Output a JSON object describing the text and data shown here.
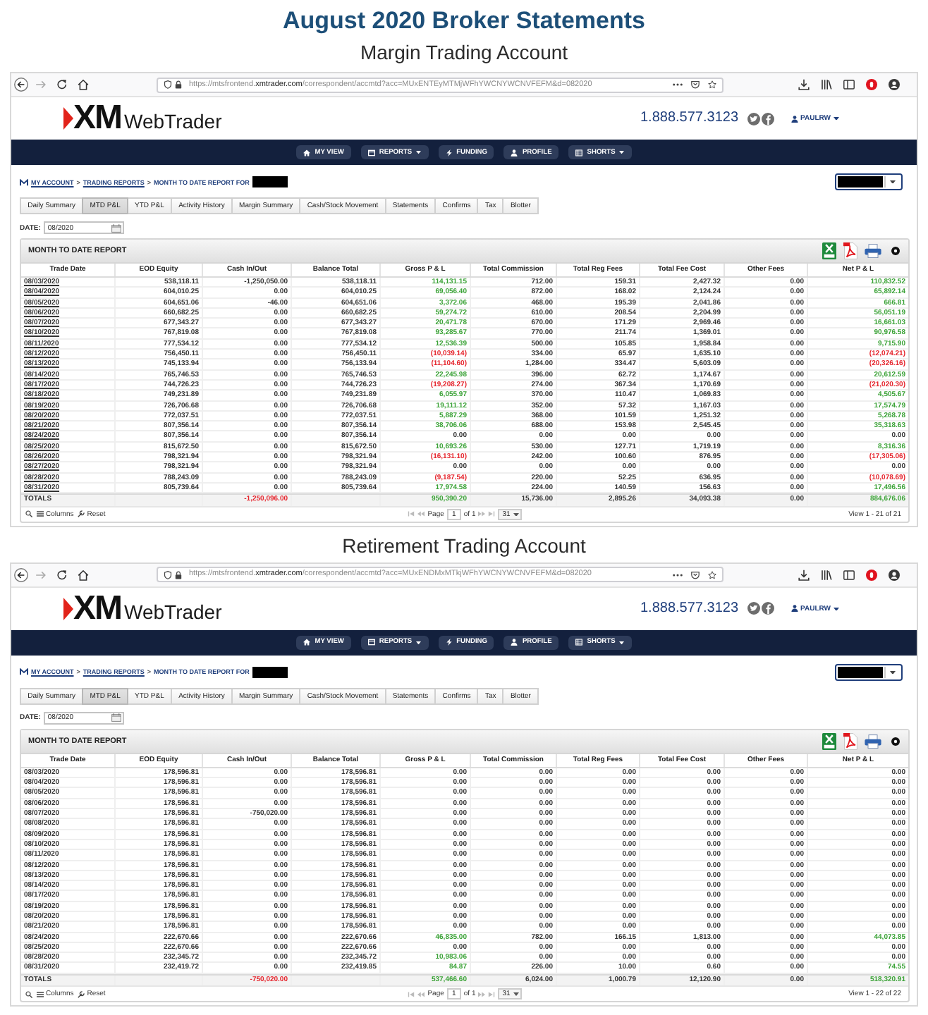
{
  "page": {
    "title": "August 2020 Broker Statements"
  },
  "sections": [
    {
      "subtitle": "Margin Trading Account",
      "browser": {
        "url_prefix": "https://mtsfrontend.",
        "url_domain": "xmtrader.com",
        "url_path": "/correspondent/accmtd?acc=MUxENTEyMTMjWFhYWCNYWCNVFEFM&d=082020"
      },
      "site": {
        "logo_mark": "XM",
        "logo_text": "WebTrader",
        "phone": "1.888.577.3123",
        "user": "PAULRW"
      },
      "nav": [
        {
          "label": "MY VIEW",
          "dropdown": false
        },
        {
          "label": "REPORTS",
          "dropdown": true
        },
        {
          "label": "FUNDING",
          "dropdown": false
        },
        {
          "label": "PROFILE",
          "dropdown": false
        },
        {
          "label": "SHORTS",
          "dropdown": true
        }
      ],
      "breadcrumb": [
        {
          "kind": "link",
          "label": "MY ACCOUNT"
        },
        {
          "kind": "separator",
          "label": ">"
        },
        {
          "kind": "link",
          "label": "TRADING REPORTS"
        },
        {
          "kind": "separator",
          "label": ">"
        },
        {
          "kind": "current",
          "label": "MONTH TO DATE REPORT FOR"
        }
      ],
      "tabs": [
        {
          "label": "Daily Summary",
          "selected": false
        },
        {
          "label": "MTD P&L",
          "selected": true
        },
        {
          "label": "YTD P&L",
          "selected": false
        },
        {
          "label": "Activity History",
          "selected": false
        },
        {
          "label": "Margin Summary",
          "selected": false
        },
        {
          "label": "Cash/Stock Movement",
          "selected": false
        },
        {
          "label": "Statements",
          "selected": false
        },
        {
          "label": "Confirms",
          "selected": false
        },
        {
          "label": "Tax",
          "selected": false
        },
        {
          "label": "Blotter",
          "selected": false
        }
      ],
      "date": {
        "label": "DATE:",
        "value": "08/2020"
      },
      "report": {
        "title": "MONTH TO DATE REPORT",
        "date_links": true,
        "columns": [
          "Trade Date",
          "EOD Equity",
          "Cash In/Out",
          "Balance Total",
          "Gross P & L",
          "Total Commission",
          "Total Reg Fees",
          "Total Fee Cost",
          "Other Fees",
          "Net P & L"
        ],
        "rows": [
          {
            "cells": [
              "08/03/2020",
              "538,118.11",
              "-1,250,050.00",
              "538,118.11",
              "114,131.15",
              "712.00",
              "159.31",
              "2,427.32",
              "0.00",
              "110,832.52"
            ],
            "gross_gain": true,
            "gross_loss": false,
            "net_gain": true,
            "net_loss": false
          },
          {
            "cells": [
              "08/04/2020",
              "604,010.25",
              "0.00",
              "604,010.25",
              "69,056.40",
              "872.00",
              "168.02",
              "2,124.24",
              "0.00",
              "65,892.14"
            ],
            "gross_gain": true,
            "gross_loss": false,
            "net_gain": true,
            "net_loss": false
          },
          {
            "cells": [
              "08/05/2020",
              "604,651.06",
              "-46.00",
              "604,651.06",
              "3,372.06",
              "468.00",
              "195.39",
              "2,041.86",
              "0.00",
              "666.81"
            ],
            "gross_gain": true,
            "gross_loss": false,
            "net_gain": true,
            "net_loss": false
          },
          {
            "cells": [
              "08/06/2020",
              "660,682.25",
              "0.00",
              "660,682.25",
              "59,274.72",
              "610.00",
              "208.54",
              "2,204.99",
              "0.00",
              "56,051.19"
            ],
            "gross_gain": true,
            "gross_loss": false,
            "net_gain": true,
            "net_loss": false
          },
          {
            "cells": [
              "08/07/2020",
              "677,343.27",
              "0.00",
              "677,343.27",
              "20,471.78",
              "670.00",
              "171.29",
              "2,969.46",
              "0.00",
              "16,661.03"
            ],
            "gross_gain": true,
            "gross_loss": false,
            "net_gain": true,
            "net_loss": false
          },
          {
            "cells": [
              "08/10/2020",
              "767,819.08",
              "0.00",
              "767,819.08",
              "93,285.67",
              "770.00",
              "211.74",
              "1,369.01",
              "0.00",
              "90,976.58"
            ],
            "gross_gain": true,
            "gross_loss": false,
            "net_gain": true,
            "net_loss": false
          },
          {
            "cells": [
              "08/11/2020",
              "777,534.12",
              "0.00",
              "777,534.12",
              "12,536.39",
              "500.00",
              "105.85",
              "1,958.84",
              "0.00",
              "9,715.90"
            ],
            "gross_gain": true,
            "gross_loss": false,
            "net_gain": true,
            "net_loss": false
          },
          {
            "cells": [
              "08/12/2020",
              "756,450.11",
              "0.00",
              "756,450.11",
              "(10,039.14)",
              "334.00",
              "65.97",
              "1,635.10",
              "0.00",
              "(12,074.21)"
            ],
            "gross_gain": false,
            "gross_loss": true,
            "net_gain": false,
            "net_loss": true
          },
          {
            "cells": [
              "08/13/2020",
              "745,133.94",
              "0.00",
              "756,133.94",
              "(11,104.60)",
              "1,284.00",
              "334.47",
              "5,603.09",
              "0.00",
              "(20,326.16)"
            ],
            "gross_gain": false,
            "gross_loss": true,
            "net_gain": false,
            "net_loss": true
          },
          {
            "cells": [
              "08/14/2020",
              "765,746.53",
              "0.00",
              "765,746.53",
              "22,245.98",
              "396.00",
              "62.72",
              "1,174.67",
              "0.00",
              "20,612.59"
            ],
            "gross_gain": true,
            "gross_loss": false,
            "net_gain": true,
            "net_loss": false
          },
          {
            "cells": [
              "08/17/2020",
              "744,726.23",
              "0.00",
              "744,726.23",
              "(19,208.27)",
              "274.00",
              "367.34",
              "1,170.69",
              "0.00",
              "(21,020.30)"
            ],
            "gross_gain": false,
            "gross_loss": true,
            "net_gain": false,
            "net_loss": true
          },
          {
            "cells": [
              "08/18/2020",
              "749,231.89",
              "0.00",
              "749,231.89",
              "6,055.97",
              "370.00",
              "110.47",
              "1,069.83",
              "0.00",
              "4,505.67"
            ],
            "gross_gain": true,
            "gross_loss": false,
            "net_gain": true,
            "net_loss": false
          },
          {
            "cells": [
              "08/19/2020",
              "726,706.68",
              "0.00",
              "726,706.68",
              "19,111.12",
              "352.00",
              "57.32",
              "1,167.03",
              "0.00",
              "17,574.79"
            ],
            "gross_gain": true,
            "gross_loss": false,
            "net_gain": true,
            "net_loss": false
          },
          {
            "cells": [
              "08/20/2020",
              "772,037.51",
              "0.00",
              "772,037.51",
              "5,887.29",
              "368.00",
              "101.59",
              "1,251.32",
              "0.00",
              "5,268.78"
            ],
            "gross_gain": true,
            "gross_loss": false,
            "net_gain": true,
            "net_loss": false
          },
          {
            "cells": [
              "08/21/2020",
              "807,356.14",
              "0.00",
              "807,356.14",
              "38,706.06",
              "688.00",
              "153.98",
              "2,545.45",
              "0.00",
              "35,318.63"
            ],
            "gross_gain": true,
            "gross_loss": false,
            "net_gain": true,
            "net_loss": false
          },
          {
            "cells": [
              "08/24/2020",
              "807,356.14",
              "0.00",
              "807,356.14",
              "0.00",
              "0.00",
              "0.00",
              "0.00",
              "0.00",
              "0.00"
            ],
            "gross_gain": false,
            "gross_loss": false,
            "net_gain": false,
            "net_loss": false
          },
          {
            "cells": [
              "08/25/2020",
              "815,672.50",
              "0.00",
              "815,672.50",
              "10,693.26",
              "530.00",
              "127.71",
              "1,719.19",
              "0.00",
              "8,316.36"
            ],
            "gross_gain": true,
            "gross_loss": false,
            "net_gain": true,
            "net_loss": false
          },
          {
            "cells": [
              "08/26/2020",
              "798,321.94",
              "0.00",
              "798,321.94",
              "(16,131.10)",
              "242.00",
              "100.60",
              "876.95",
              "0.00",
              "(17,305.06)"
            ],
            "gross_gain": false,
            "gross_loss": true,
            "net_gain": false,
            "net_loss": true
          },
          {
            "cells": [
              "08/27/2020",
              "798,321.94",
              "0.00",
              "798,321.94",
              "0.00",
              "0.00",
              "0.00",
              "0.00",
              "0.00",
              "0.00"
            ],
            "gross_gain": false,
            "gross_loss": false,
            "net_gain": false,
            "net_loss": false
          },
          {
            "cells": [
              "08/28/2020",
              "788,243.09",
              "0.00",
              "788,243.09",
              "(9,187.54)",
              "220.00",
              "52.25",
              "636.95",
              "0.00",
              "(10,078.69)"
            ],
            "gross_gain": false,
            "gross_loss": true,
            "net_gain": false,
            "net_loss": true
          },
          {
            "cells": [
              "08/31/2020",
              "805,739.64",
              "0.00",
              "805,739.64",
              "17,974.58",
              "224.00",
              "140.59",
              "156.63",
              "0.00",
              "17,496.56"
            ],
            "gross_gain": true,
            "gross_loss": false,
            "net_gain": true,
            "net_loss": false
          }
        ],
        "totals": {
          "label": "TOTALS",
          "cash_in_out": "-1,250,096.00",
          "cash_gain": false,
          "cash_loss": true,
          "gross_p_l": "950,390.20",
          "gross_gain": true,
          "gross_loss": false,
          "total_commission": "15,736.00",
          "total_reg_fees": "2,895.26",
          "total_fee_cost": "34,093.38",
          "other_fees": "0.00",
          "net_p_l": "884,676.06",
          "net_gain": true,
          "net_loss": false
        },
        "pager": {
          "columns": "Columns",
          "reset": "Reset",
          "page_label": "Page",
          "page": "1",
          "page_of": "of 1",
          "page_size": "31",
          "view": "View 1 - 21 of 21"
        }
      }
    },
    {
      "subtitle": "Retirement Trading Account",
      "browser": {
        "url_prefix": "https://mtsfrontend.",
        "url_domain": "xmtrader.com",
        "url_path": "/correspondent/accmtd?acc=MUxENDMxMTkjWFhYWCNYWCNVFEFM&d=082020"
      },
      "site": {
        "logo_mark": "XM",
        "logo_text": "WebTrader",
        "phone": "1.888.577.3123",
        "user": "PAULRW"
      },
      "nav": [
        {
          "label": "MY VIEW",
          "dropdown": false
        },
        {
          "label": "REPORTS",
          "dropdown": true
        },
        {
          "label": "FUNDING",
          "dropdown": false
        },
        {
          "label": "PROFILE",
          "dropdown": false
        },
        {
          "label": "SHORTS",
          "dropdown": true
        }
      ],
      "breadcrumb": [
        {
          "kind": "link",
          "label": "MY ACCOUNT"
        },
        {
          "kind": "separator",
          "label": ">"
        },
        {
          "kind": "link",
          "label": "TRADING REPORTS"
        },
        {
          "kind": "separator",
          "label": ">"
        },
        {
          "kind": "current",
          "label": "MONTH TO DATE REPORT FOR"
        }
      ],
      "tabs": [
        {
          "label": "Daily Summary",
          "selected": false
        },
        {
          "label": "MTD P&L",
          "selected": true
        },
        {
          "label": "YTD P&L",
          "selected": false
        },
        {
          "label": "Activity History",
          "selected": false
        },
        {
          "label": "Margin Summary",
          "selected": false
        },
        {
          "label": "Cash/Stock Movement",
          "selected": false
        },
        {
          "label": "Statements",
          "selected": false
        },
        {
          "label": "Confirms",
          "selected": false
        },
        {
          "label": "Tax",
          "selected": false
        },
        {
          "label": "Blotter",
          "selected": false
        }
      ],
      "date": {
        "label": "DATE:",
        "value": "08/2020"
      },
      "report": {
        "title": "MONTH TO DATE REPORT",
        "date_links": false,
        "columns": [
          "Trade Date",
          "EOD Equity",
          "Cash In/Out",
          "Balance Total",
          "Gross P & L",
          "Total Commission",
          "Total Reg Fees",
          "Total Fee Cost",
          "Other Fees",
          "Net P & L"
        ],
        "rows": [
          {
            "cells": [
              "08/03/2020",
              "178,596.81",
              "0.00",
              "178,596.81",
              "0.00",
              "0.00",
              "0.00",
              "0.00",
              "0.00",
              "0.00"
            ],
            "gross_gain": false,
            "gross_loss": false,
            "net_gain": false,
            "net_loss": false
          },
          {
            "cells": [
              "08/04/2020",
              "178,596.81",
              "0.00",
              "178,596.81",
              "0.00",
              "0.00",
              "0.00",
              "0.00",
              "0.00",
              "0.00"
            ],
            "gross_gain": false,
            "gross_loss": false,
            "net_gain": false,
            "net_loss": false
          },
          {
            "cells": [
              "08/05/2020",
              "178,596.81",
              "0.00",
              "178,596.81",
              "0.00",
              "0.00",
              "0.00",
              "0.00",
              "0.00",
              "0.00"
            ],
            "gross_gain": false,
            "gross_loss": false,
            "net_gain": false,
            "net_loss": false
          },
          {
            "cells": [
              "08/06/2020",
              "178,596.81",
              "0.00",
              "178,596.81",
              "0.00",
              "0.00",
              "0.00",
              "0.00",
              "0.00",
              "0.00"
            ],
            "gross_gain": false,
            "gross_loss": false,
            "net_gain": false,
            "net_loss": false
          },
          {
            "cells": [
              "08/07/2020",
              "178,596.81",
              "-750,020.00",
              "178,596.81",
              "0.00",
              "0.00",
              "0.00",
              "0.00",
              "0.00",
              "0.00"
            ],
            "gross_gain": false,
            "gross_loss": false,
            "net_gain": false,
            "net_loss": false
          },
          {
            "cells": [
              "08/08/2020",
              "178,596.81",
              "0.00",
              "178,596.81",
              "0.00",
              "0.00",
              "0.00",
              "0.00",
              "0.00",
              "0.00"
            ],
            "gross_gain": false,
            "gross_loss": false,
            "net_gain": false,
            "net_loss": false
          },
          {
            "cells": [
              "08/09/2020",
              "178,596.81",
              "0.00",
              "178,596.81",
              "0.00",
              "0.00",
              "0.00",
              "0.00",
              "0.00",
              "0.00"
            ],
            "gross_gain": false,
            "gross_loss": false,
            "net_gain": false,
            "net_loss": false
          },
          {
            "cells": [
              "08/10/2020",
              "178,596.81",
              "0.00",
              "178,596.81",
              "0.00",
              "0.00",
              "0.00",
              "0.00",
              "0.00",
              "0.00"
            ],
            "gross_gain": false,
            "gross_loss": false,
            "net_gain": false,
            "net_loss": false
          },
          {
            "cells": [
              "08/11/2020",
              "178,596.81",
              "0.00",
              "178,596.81",
              "0.00",
              "0.00",
              "0.00",
              "0.00",
              "0.00",
              "0.00"
            ],
            "gross_gain": false,
            "gross_loss": false,
            "net_gain": false,
            "net_loss": false
          },
          {
            "cells": [
              "08/12/2020",
              "178,596.81",
              "0.00",
              "178,596.81",
              "0.00",
              "0.00",
              "0.00",
              "0.00",
              "0.00",
              "0.00"
            ],
            "gross_gain": false,
            "gross_loss": false,
            "net_gain": false,
            "net_loss": false
          },
          {
            "cells": [
              "08/13/2020",
              "178,596.81",
              "0.00",
              "178,596.81",
              "0.00",
              "0.00",
              "0.00",
              "0.00",
              "0.00",
              "0.00"
            ],
            "gross_gain": false,
            "gross_loss": false,
            "net_gain": false,
            "net_loss": false
          },
          {
            "cells": [
              "08/14/2020",
              "178,596.81",
              "0.00",
              "178,596.81",
              "0.00",
              "0.00",
              "0.00",
              "0.00",
              "0.00",
              "0.00"
            ],
            "gross_gain": false,
            "gross_loss": false,
            "net_gain": false,
            "net_loss": false
          },
          {
            "cells": [
              "08/17/2020",
              "178,596.81",
              "0.00",
              "178,596.81",
              "0.00",
              "0.00",
              "0.00",
              "0.00",
              "0.00",
              "0.00"
            ],
            "gross_gain": false,
            "gross_loss": false,
            "net_gain": false,
            "net_loss": false
          },
          {
            "cells": [
              "08/19/2020",
              "178,596.81",
              "0.00",
              "178,596.81",
              "0.00",
              "0.00",
              "0.00",
              "0.00",
              "0.00",
              "0.00"
            ],
            "gross_gain": false,
            "gross_loss": false,
            "net_gain": false,
            "net_loss": false
          },
          {
            "cells": [
              "08/20/2020",
              "178,596.81",
              "0.00",
              "178,596.81",
              "0.00",
              "0.00",
              "0.00",
              "0.00",
              "0.00",
              "0.00"
            ],
            "gross_gain": false,
            "gross_loss": false,
            "net_gain": false,
            "net_loss": false
          },
          {
            "cells": [
              "08/21/2020",
              "178,596.81",
              "0.00",
              "178,596.81",
              "0.00",
              "0.00",
              "0.00",
              "0.00",
              "0.00",
              "0.00"
            ],
            "gross_gain": false,
            "gross_loss": false,
            "net_gain": false,
            "net_loss": false
          },
          {
            "cells": [
              "08/24/2020",
              "222,670.66",
              "0.00",
              "222,670.66",
              "46,835.00",
              "782.00",
              "166.15",
              "1,813.00",
              "0.00",
              "44,073.85"
            ],
            "gross_gain": true,
            "gross_loss": false,
            "net_gain": true,
            "net_loss": false
          },
          {
            "cells": [
              "08/25/2020",
              "222,670.66",
              "0.00",
              "222,670.66",
              "0.00",
              "0.00",
              "0.00",
              "0.00",
              "0.00",
              "0.00"
            ],
            "gross_gain": false,
            "gross_loss": false,
            "net_gain": false,
            "net_loss": false
          },
          {
            "cells": [
              "08/28/2020",
              "232,345.72",
              "0.00",
              "232,345.72",
              "10,983.06",
              "0.00",
              "0.00",
              "0.00",
              "0.00",
              "0.00"
            ],
            "gross_gain": true,
            "gross_loss": false,
            "net_gain": false,
            "net_loss": false
          },
          {
            "cells": [
              "08/31/2020",
              "232,419.72",
              "0.00",
              "232,419.85",
              "84.87",
              "226.00",
              "10.00",
              "0.60",
              "0.00",
              "74.55"
            ],
            "gross_gain": true,
            "gross_loss": false,
            "net_gain": true,
            "net_loss": false
          }
        ],
        "totals": {
          "label": "TOTALS",
          "cash_in_out": "-750,020.00",
          "cash_gain": false,
          "cash_loss": true,
          "gross_p_l": "537,466.60",
          "gross_gain": true,
          "gross_loss": false,
          "total_commission": "6,024.00",
          "total_reg_fees": "1,000.79",
          "total_fee_cost": "12,120.90",
          "other_fees": "0.00",
          "net_p_l": "518,320.91",
          "net_gain": true,
          "net_loss": false
        },
        "pager": {
          "columns": "Columns",
          "reset": "Reset",
          "page_label": "Page",
          "page": "1",
          "page_of": "of 1",
          "page_size": "31",
          "view": "View 1 - 22 of 22"
        }
      }
    }
  ]
}
